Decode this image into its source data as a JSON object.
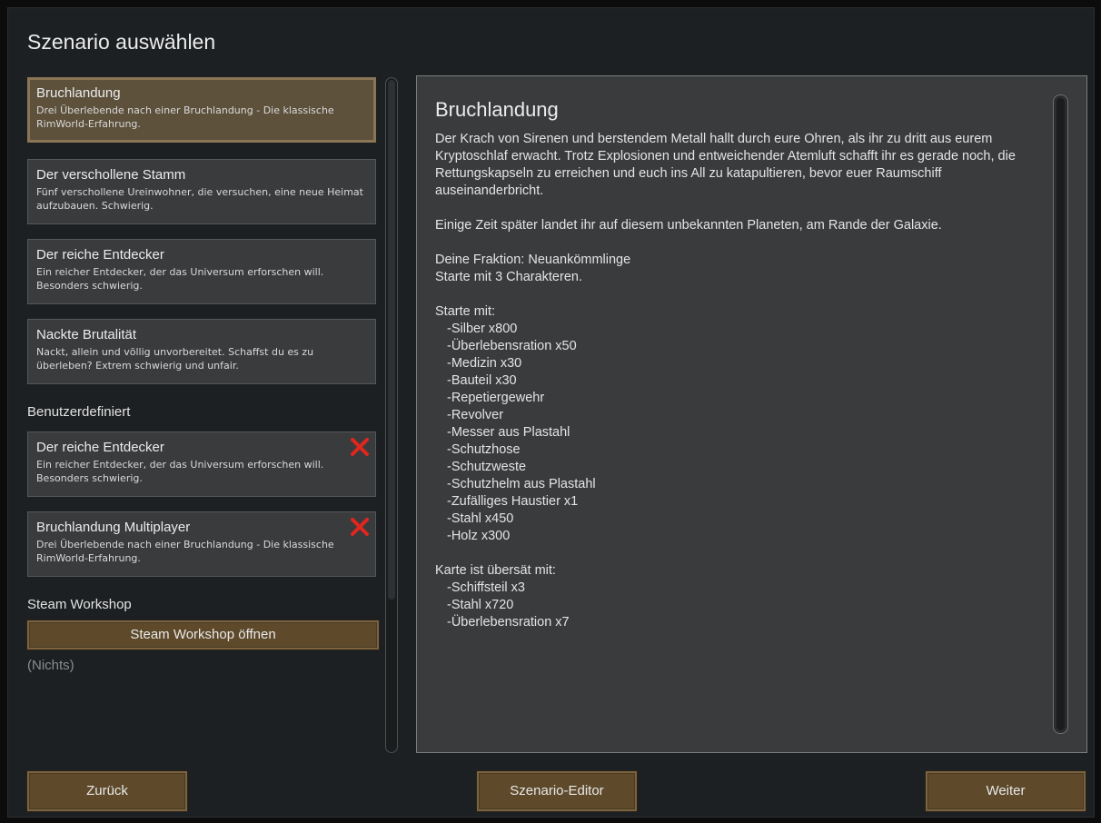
{
  "window": {
    "title": "Szenario auswählen"
  },
  "scenarios": [
    {
      "title": "Bruchlandung",
      "description": "Drei Überlebende nach einer Bruchlandung - Die klassische RimWorld-Erfahrung.",
      "selected": true
    },
    {
      "title": "Der verschollene Stamm",
      "description": "Fünf verschollene Ureinwohner, die versuchen, eine neue Heimat aufzubauen. Schwierig."
    },
    {
      "title": "Der reiche Entdecker",
      "description": "Ein reicher Entdecker, der das Universum erforschen will. Besonders schwierig."
    },
    {
      "title": "Nackte Brutalität",
      "description": "Nackt, allein und völlig unvorbereitet. Schaffst du es zu überleben? Extrem schwierig und unfair."
    }
  ],
  "custom": {
    "label": "Benutzerdefiniert",
    "scenarios": [
      {
        "title": "Der reiche Entdecker",
        "description": "Ein reicher Entdecker, der das Universum erforschen will. Besonders schwierig.",
        "delete_icon": "close-x-icon"
      },
      {
        "title": "Bruchlandung Multiplayer",
        "description": "Drei Überlebende nach einer Bruchlandung - Die klassische RimWorld-Erfahrung.",
        "delete_icon": "close-x-icon"
      }
    ]
  },
  "workshop": {
    "label": "Steam Workshop",
    "button_label": "Steam Workshop öffnen",
    "empty_label": "(Nichts)"
  },
  "detail": {
    "title": "Bruchlandung",
    "intro": "Der Krach von Sirenen und berstendem Metall hallt durch eure Ohren, als ihr zu dritt aus eurem Kryptoschlaf erwacht. Trotz Explosionen und entweichender Atemluft schafft ihr es gerade noch, die Rettungskapseln zu erreichen und euch ins All zu katapultieren, bevor euer Raumschiff auseinanderbricht.",
    "landing": "Einige Zeit später landet ihr auf diesem unbekannten Planeten, am Rande der Galaxie.",
    "faction": "Deine Fraktion: Neuankömmlinge",
    "start_chars": "Starte mit 3 Charakteren.",
    "start_with_label": "Starte mit:",
    "start_items": [
      "-Silber x800",
      "-Überlebensration x50",
      "-Medizin x30",
      "-Bauteil x30",
      "-Repetiergewehr",
      "-Revolver",
      "-Messer aus Plastahl",
      "-Schutzhose",
      "-Schutzweste",
      "-Schutzhelm aus Plastahl",
      "-Zufälliges Haustier x1",
      "-Stahl x450",
      "-Holz x300"
    ],
    "map_label": "Karte ist übersät mit:",
    "map_items": [
      "-Schiffsteil x3",
      "-Stahl x720",
      "-Überlebensration x7"
    ]
  },
  "footer": {
    "back_label": "Zurück",
    "editor_label": "Szenario-Editor",
    "next_label": "Weiter"
  },
  "colors": {
    "background": "#1d2022",
    "card": "#3a3b3d",
    "card_selected": "#5d513c",
    "button": "#5e4a2b",
    "delete_red": "#e0261f"
  }
}
